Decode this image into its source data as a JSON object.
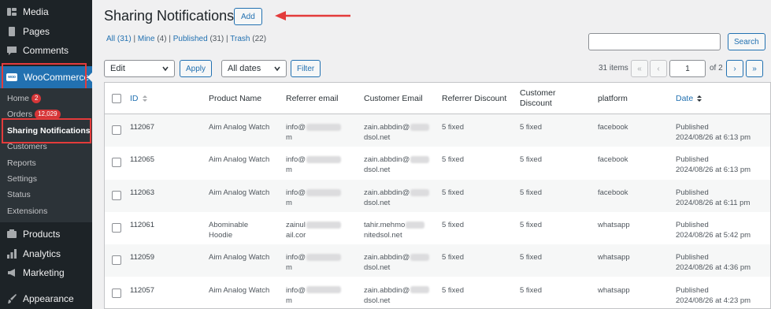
{
  "sidebar": {
    "media": "Media",
    "pages": "Pages",
    "comments": "Comments",
    "woocommerce": "WooCommerce",
    "wc_logo_text": "woo",
    "submenu": {
      "home": "Home",
      "home_badge": "2",
      "orders": "Orders",
      "orders_badge": "12,029",
      "sharing": "Sharing Notifications",
      "customers": "Customers",
      "reports": "Reports",
      "settings": "Settings",
      "status": "Status",
      "extensions": "Extensions"
    },
    "products": "Products",
    "analytics": "Analytics",
    "marketing": "Marketing",
    "appearance": "Appearance"
  },
  "header": {
    "title": "Sharing Notifications",
    "add_label": "Add"
  },
  "views": {
    "all": "All",
    "all_count": "(31)",
    "mine": "Mine",
    "mine_count": "(4)",
    "published": "Published",
    "published_count": "(31)",
    "trash": "Trash",
    "trash_count": "(22)",
    "sep": "|"
  },
  "search": {
    "button_label": "Search",
    "placeholder": ""
  },
  "toolbar": {
    "bulk_action": "Edit",
    "apply": "Apply",
    "date_filter": "All dates",
    "filter": "Filter"
  },
  "pagination": {
    "items": "31 items",
    "first": "«",
    "prev": "‹",
    "current_page": "1",
    "of_pages": "of 2",
    "next": "›",
    "last": "»"
  },
  "table": {
    "columns": {
      "id": "ID",
      "product": "Product Name",
      "referrer_email": "Referrer email",
      "customer_email": "Customer Email",
      "referrer_discount": "Referrer Discount",
      "customer_discount_1": "Customer",
      "customer_discount_2": "Discount",
      "platform": "platform",
      "date": "Date"
    },
    "rows": [
      {
        "id": "112067",
        "product_1": "Aim Analog Watch",
        "product_2": "",
        "ref_1": "info@",
        "ref_2": "m",
        "cust_1": "zain.abbdin@",
        "cust_2": "dsol.net",
        "ref_disc": "5 fixed",
        "cust_disc": "5 fixed",
        "platform": "facebook",
        "status": "Published",
        "date": "2024/08/26 at 6:13 pm"
      },
      {
        "id": "112065",
        "product_1": "Aim Analog Watch",
        "product_2": "",
        "ref_1": "info@",
        "ref_2": "m",
        "cust_1": "zain.abbdin@",
        "cust_2": "dsol.net",
        "ref_disc": "5 fixed",
        "cust_disc": "5 fixed",
        "platform": "facebook",
        "status": "Published",
        "date": "2024/08/26 at 6:13 pm"
      },
      {
        "id": "112063",
        "product_1": "Aim Analog Watch",
        "product_2": "",
        "ref_1": "info@",
        "ref_2": "m",
        "cust_1": "zain.abbdin@",
        "cust_2": "dsol.net",
        "ref_disc": "5 fixed",
        "cust_disc": "5 fixed",
        "platform": "facebook",
        "status": "Published",
        "date": "2024/08/26 at 6:11 pm"
      },
      {
        "id": "112061",
        "product_1": "Abominable",
        "product_2": "Hoodie",
        "ref_1": "zainul",
        "ref_2": "ail.cor",
        "cust_1": "tahir.mehmo",
        "cust_2": "nitedsol.net",
        "ref_disc": "5 fixed",
        "cust_disc": "5 fixed",
        "platform": "whatsapp",
        "status": "Published",
        "date": "2024/08/26 at 5:42 pm"
      },
      {
        "id": "112059",
        "product_1": "Aim Analog Watch",
        "product_2": "",
        "ref_1": "info@",
        "ref_2": "m",
        "cust_1": "zain.abbdin@",
        "cust_2": "dsol.net",
        "ref_disc": "5 fixed",
        "cust_disc": "5 fixed",
        "platform": "whatsapp",
        "status": "Published",
        "date": "2024/08/26 at 4:36 pm"
      },
      {
        "id": "112057",
        "product_1": "Aim Analog Watch",
        "product_2": "",
        "ref_1": "info@",
        "ref_2": "m",
        "cust_1": "zain.abbdin@",
        "cust_2": "dsol.net",
        "ref_disc": "5 fixed",
        "cust_disc": "5 fixed",
        "platform": "whatsapp",
        "status": "Published",
        "date": "2024/08/26 at 4:23 pm"
      }
    ]
  },
  "colors": {
    "sidebar_bg": "#1d2327",
    "accent": "#2271b1",
    "annotation": "#e33b3b"
  }
}
